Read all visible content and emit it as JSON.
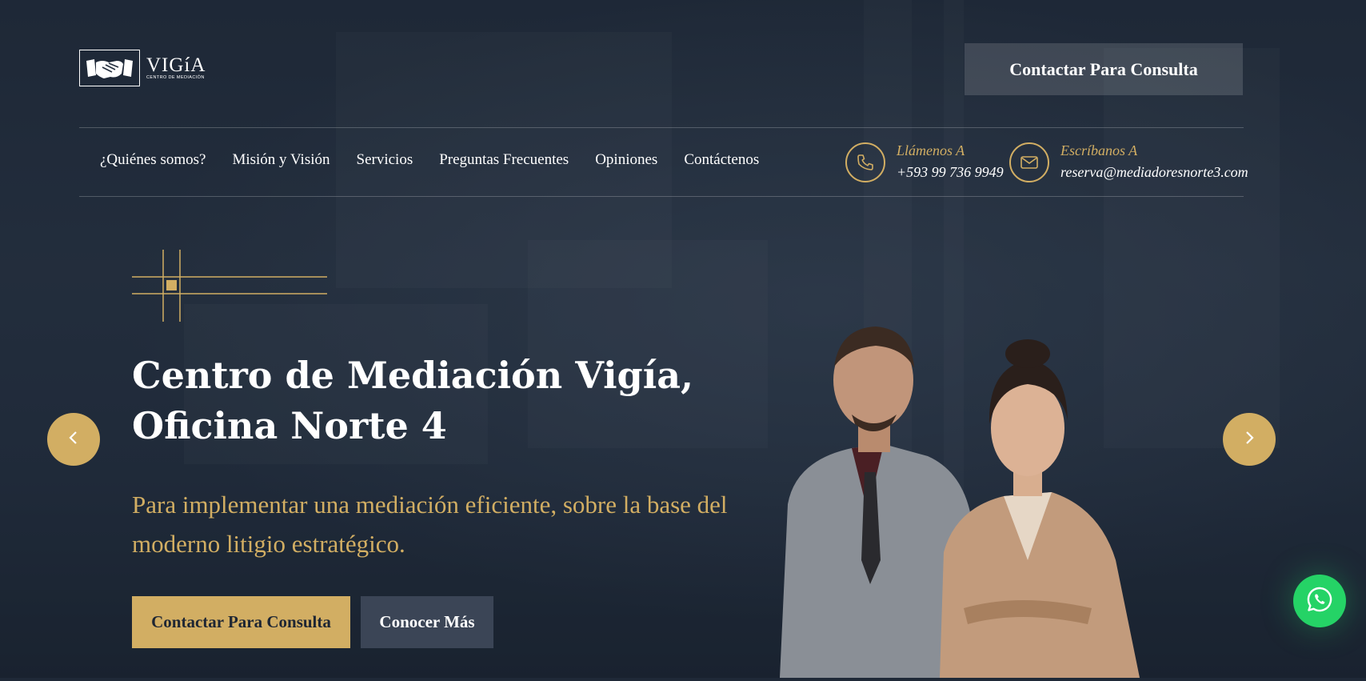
{
  "brand": {
    "name": "VIGíA",
    "subtitle": "CENTRO DE MEDIACIÓN",
    "icon": "handshake-icon"
  },
  "header": {
    "cta_label": "Contactar Para Consulta"
  },
  "nav": {
    "items": [
      {
        "label": "¿Quiénes somos?"
      },
      {
        "label": "Misión y Visión"
      },
      {
        "label": "Servicios"
      },
      {
        "label": "Preguntas Frecuentes"
      },
      {
        "label": "Opiniones"
      },
      {
        "label": "Contáctenos"
      }
    ]
  },
  "contact": {
    "phone": {
      "label": "Llámenos A",
      "value": "+593 99 736 9949",
      "icon": "phone-icon"
    },
    "email": {
      "label": "Escríbanos A",
      "value": "reserva@mediadoresnorte3.com",
      "icon": "envelope-icon"
    }
  },
  "hero": {
    "title": "Centro de Mediación Vigía, Oficina Norte 4",
    "subtitle": "Para implementar una mediación eficiente, sobre la base del moderno litigio estratégico.",
    "primary_button": "Contactar Para Consulta",
    "secondary_button": "Conocer Más"
  },
  "slider": {
    "prev_icon": "chevron-left-icon",
    "next_icon": "chevron-right-icon"
  },
  "floating": {
    "whatsapp_icon": "whatsapp-icon"
  },
  "colors": {
    "accent": "#d2ae63",
    "background": "#242f3f",
    "whatsapp": "#25d366"
  }
}
